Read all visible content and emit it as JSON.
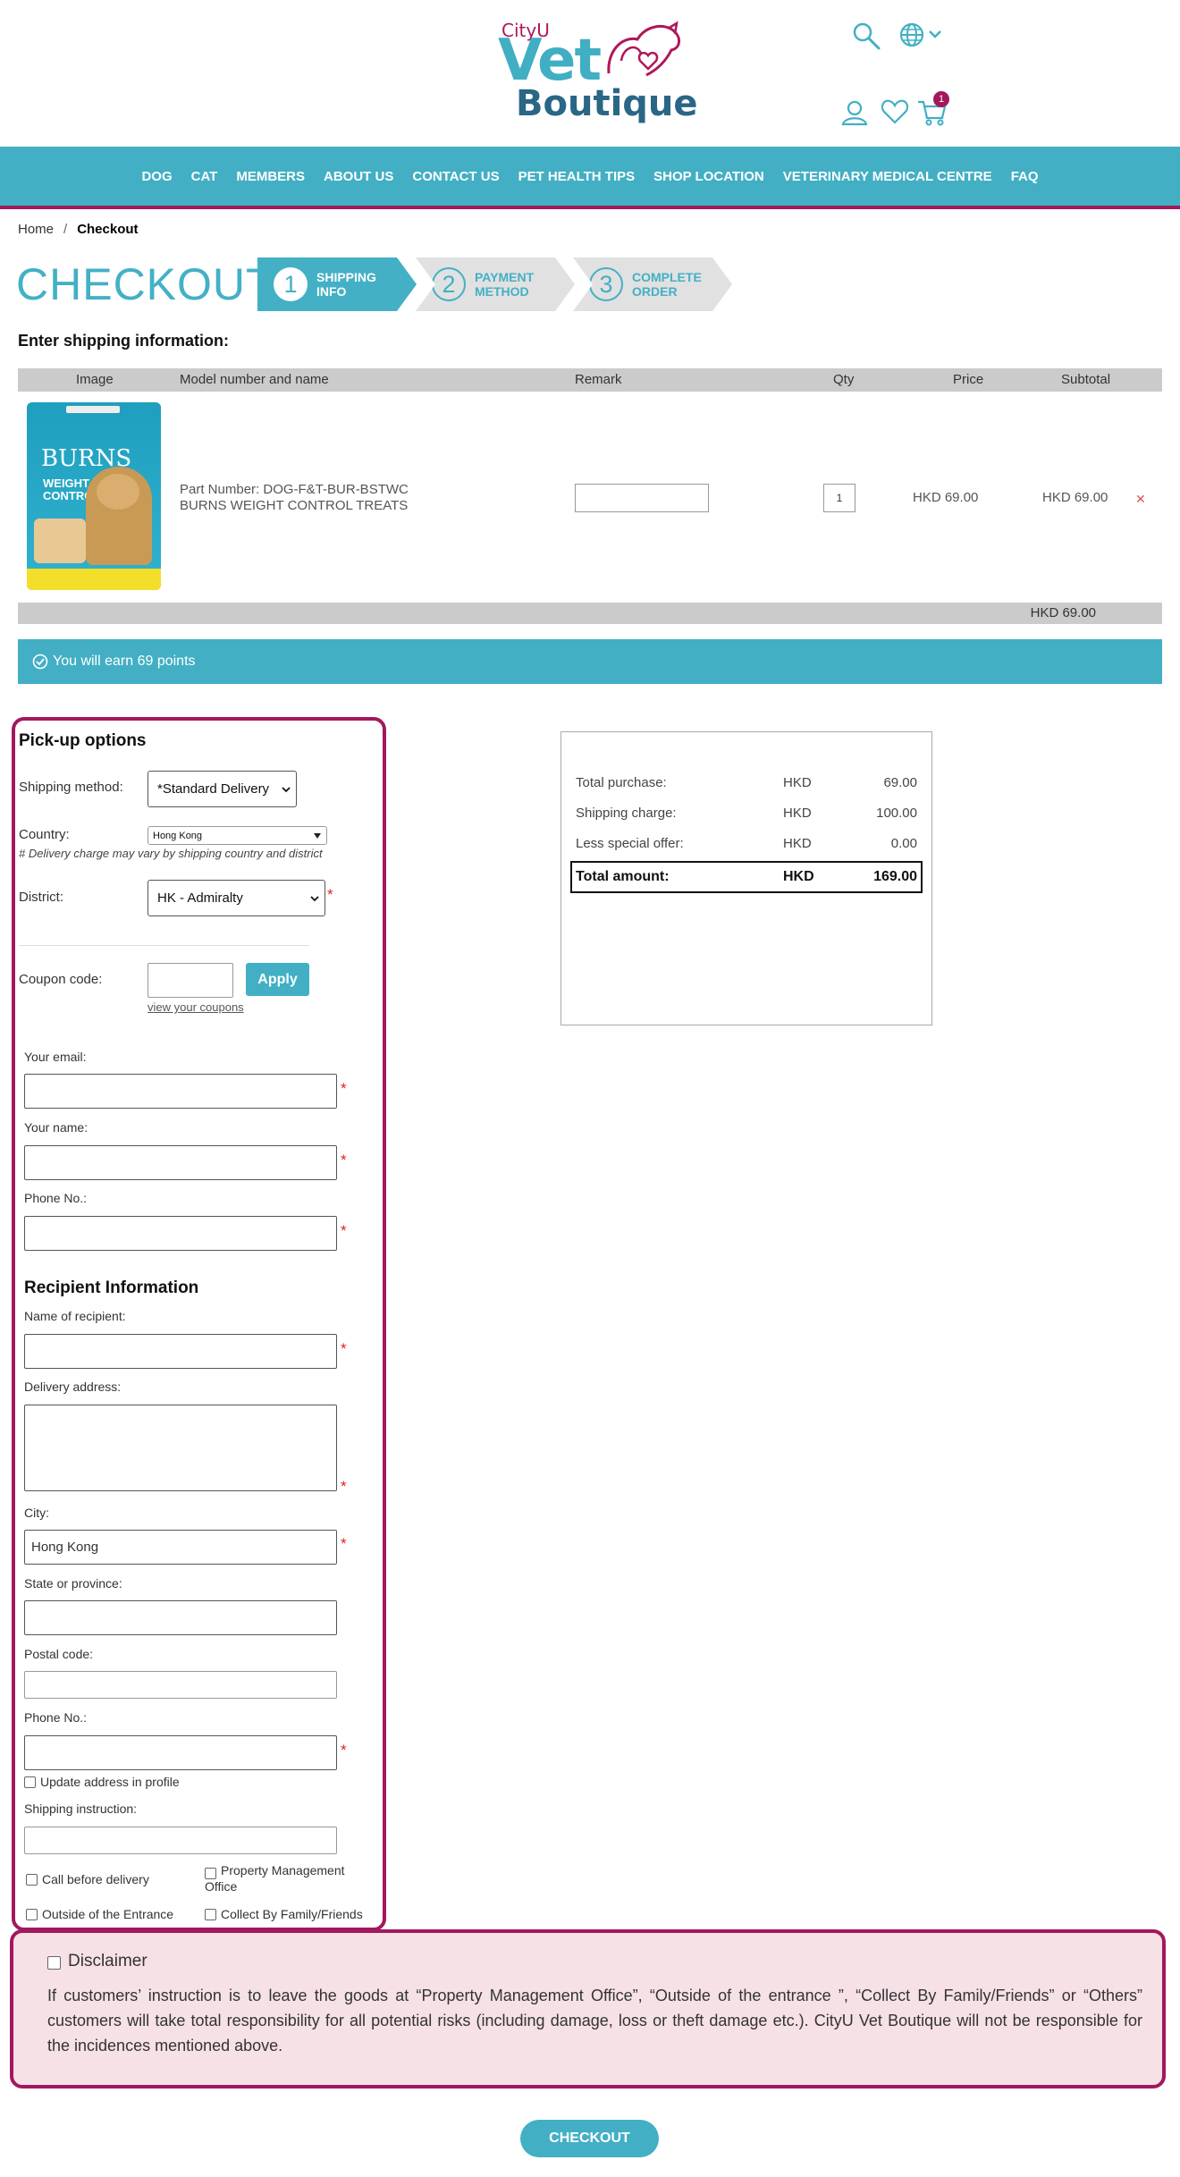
{
  "brand": {
    "top": "CityU",
    "middle": "Vet",
    "bottom": "Boutique"
  },
  "header": {
    "cart_count": "1"
  },
  "nav": [
    "DOG",
    "CAT",
    "MEMBERS",
    "ABOUT US",
    "CONTACT US",
    "PET HEALTH TIPS",
    "SHOP LOCATION",
    "VETERINARY MEDICAL CENTRE",
    "FAQ"
  ],
  "breadcrumb": {
    "home": "Home",
    "sep": "/",
    "current": "Checkout"
  },
  "page_title": "CHECKOUT",
  "steps": [
    {
      "num": "1",
      "line1": "SHIPPING",
      "line2": "INFO"
    },
    {
      "num": "2",
      "line1": "PAYMENT",
      "line2": "METHOD"
    },
    {
      "num": "3",
      "line1": "COMPLETE",
      "line2": "ORDER"
    }
  ],
  "shipping_heading": "Enter shipping information:",
  "cart": {
    "columns": {
      "image": "Image",
      "model": "Model number and name",
      "remark": "Remark",
      "qty": "Qty",
      "price": "Price",
      "subtotal": "Subtotal"
    },
    "item": {
      "part_number": "Part Number: DOG-F&T-BUR-BSTWC",
      "name": "BURNS WEIGHT CONTROL TREATS",
      "qty": "1",
      "price": "HKD 69.00",
      "subtotal": "HKD 69.00",
      "remove": "✕",
      "package_brand": "BURNS",
      "package_line1": "WEIGHT",
      "package_line2": "CONTROL"
    },
    "total": "HKD 69.00"
  },
  "points_message": "You will earn 69 points",
  "pickup": {
    "title": "Pick-up options",
    "shipping_method_label": "Shipping method:",
    "shipping_method_value": "*Standard Delivery",
    "country_label": "Country:",
    "country_value": "Hong Kong",
    "delivery_note": "# Delivery charge may vary by shipping country and district",
    "district_label": "District:",
    "district_value": "HK - Admiralty",
    "coupon_label": "Coupon code:",
    "apply_label": "Apply",
    "view_coupons": "view your coupons",
    "email_label": "Your email:",
    "name_label": "Your name:",
    "phone_label": "Phone No.:"
  },
  "recipient": {
    "title": "Recipient Information",
    "name_label": "Name of recipient:",
    "address_label": "Delivery address:",
    "city_label": "City:",
    "city_value": "Hong Kong",
    "state_label": "State or province:",
    "postal_label": "Postal code:",
    "phone_label": "Phone No.:",
    "update_profile": "Update address in profile",
    "instruction_label": "Shipping instruction:",
    "options": [
      "Call before delivery",
      "Property Management Office",
      "Outside of the Entrance",
      "Collect By Family/Friends"
    ]
  },
  "summary": {
    "rows": [
      {
        "label": "Total purchase:",
        "cur": "HKD",
        "amount": "69.00"
      },
      {
        "label": "Shipping charge:",
        "cur": "HKD",
        "amount": "100.00"
      },
      {
        "label": "Less special offer:",
        "cur": "HKD",
        "amount": "0.00"
      }
    ],
    "total": {
      "label": "Total amount:",
      "cur": "HKD",
      "amount": "169.00"
    }
  },
  "disclaimer": {
    "label": "Disclaimer",
    "text": "If customers’ instruction is to leave the goods at “Property Management Office”, “Outside of the entrance ”, “Collect By Family/Friends” or “Others” customers will take total responsibility for all potential risks (including damage, loss or theft damage etc.). CityU Vet Boutique will not be responsible for the incidences mentioned above."
  },
  "checkout_button": "CHECKOUT",
  "colors": {
    "teal": "#42afc4",
    "magenta": "#a2185d",
    "navy": "#2a6686"
  }
}
